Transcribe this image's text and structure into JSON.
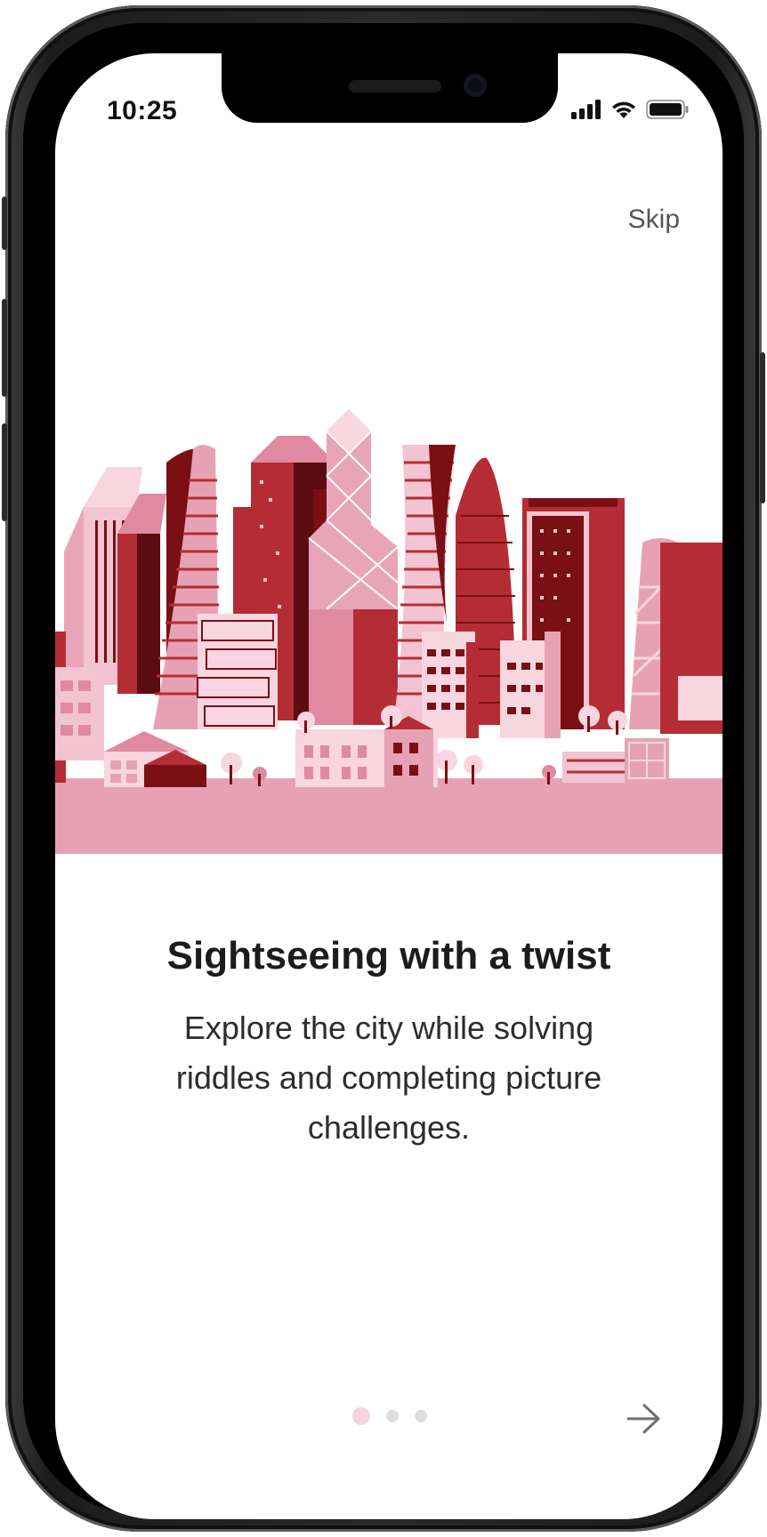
{
  "status_bar": {
    "time": "10:25"
  },
  "onboarding": {
    "skip_label": "Skip",
    "title": "Sightseeing with a twist",
    "description": "Explore the city while solving riddles and completing picture challenges.",
    "page_count": 3,
    "current_page": 1
  },
  "icons": {
    "signal": "cellular-signal-icon",
    "wifi": "wifi-icon",
    "battery": "battery-icon",
    "next": "arrow-right-icon"
  },
  "colors": {
    "accent_pink": "#f3d3de",
    "illustration_dark": "#7a0f14",
    "illustration_mid": "#b52d34",
    "illustration_light": "#e8a3b6"
  }
}
